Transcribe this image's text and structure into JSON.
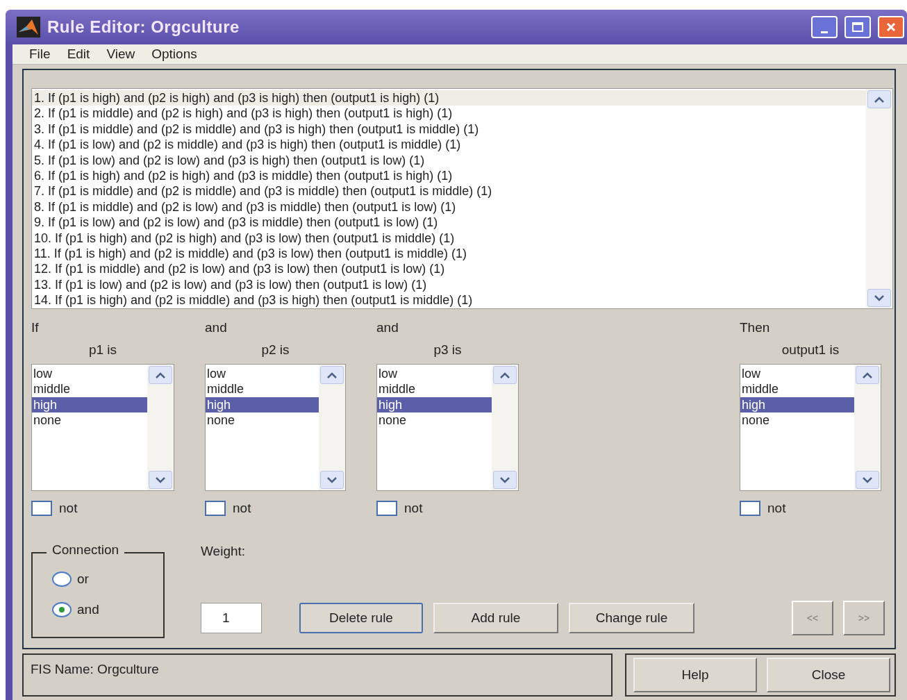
{
  "window": {
    "title": "Rule Editor: Orgculture"
  },
  "menu": [
    "File",
    "Edit",
    "View",
    "Options"
  ],
  "rules": [
    {
      "text": "1. If (p1 is high) and (p2 is high) and (p3 is high) then (output1 is high) (1)",
      "selected": true
    },
    {
      "text": "2. If (p1 is middle) and (p2 is high) and (p3 is high) then (output1 is high) (1)",
      "selected": false
    },
    {
      "text": "3. If (p1 is middle) and (p2 is middle) and (p3 is high) then (output1 is middle) (1)",
      "selected": false
    },
    {
      "text": "4. If (p1 is low) and (p2 is middle) and (p3 is high) then (output1 is middle) (1)",
      "selected": false
    },
    {
      "text": "5. If (p1 is low) and (p2 is low) and (p3 is high) then (output1 is low) (1)",
      "selected": false
    },
    {
      "text": "6. If (p1 is high) and (p2 is high) and (p3 is middle) then (output1 is high) (1)",
      "selected": false
    },
    {
      "text": "7. If (p1 is middle) and (p2 is middle) and (p3 is middle) then (output1 is middle) (1)",
      "selected": false
    },
    {
      "text": "8. If (p1 is middle) and (p2 is low) and (p3 is middle) then (output1 is low) (1)",
      "selected": false
    },
    {
      "text": "9. If (p1 is low) and (p2 is low) and (p3 is middle) then (output1 is low) (1)",
      "selected": false
    },
    {
      "text": "10. If (p1 is high) and (p2 is high) and (p3 is low) then (output1 is middle) (1)",
      "selected": false
    },
    {
      "text": "11. If (p1 is high) and (p2 is middle) and (p3 is low) then (output1 is middle) (1)",
      "selected": false
    },
    {
      "text": "12. If (p1 is middle) and (p2 is low) and (p3 is low) then (output1 is low) (1)",
      "selected": false
    },
    {
      "text": "13. If (p1 is low) and (p2 is low) and (p3 is low) then (output1 is low) (1)",
      "selected": false
    },
    {
      "text": "14. If (p1 is high) and (p2 is middle) and (p3 is high) then (output1 is middle) (1)",
      "selected": false
    }
  ],
  "columns": [
    {
      "kind": "input",
      "connector": "If",
      "label": "p1 is",
      "options": [
        {
          "label": "low",
          "selected": false
        },
        {
          "label": "middle",
          "selected": false
        },
        {
          "label": "high",
          "selected": true
        },
        {
          "label": "none",
          "selected": false
        }
      ],
      "not_label": "not",
      "not_checked": false
    },
    {
      "kind": "input",
      "connector": "and",
      "label": "p2 is",
      "options": [
        {
          "label": "low",
          "selected": false
        },
        {
          "label": "middle",
          "selected": false
        },
        {
          "label": "high",
          "selected": true
        },
        {
          "label": "none",
          "selected": false
        }
      ],
      "not_label": "not",
      "not_checked": false
    },
    {
      "kind": "input",
      "connector": "and",
      "label": "p3 is",
      "options": [
        {
          "label": "low",
          "selected": false
        },
        {
          "label": "middle",
          "selected": false
        },
        {
          "label": "high",
          "selected": true
        },
        {
          "label": "none",
          "selected": false
        }
      ],
      "not_label": "not",
      "not_checked": false
    },
    {
      "kind": "output",
      "connector": "Then",
      "label": "output1 is",
      "options": [
        {
          "label": "low",
          "selected": false
        },
        {
          "label": "middle",
          "selected": false
        },
        {
          "label": "high",
          "selected": true
        },
        {
          "label": "none",
          "selected": false
        }
      ],
      "not_label": "not",
      "not_checked": false
    }
  ],
  "connection": {
    "label": "Connection",
    "options": [
      {
        "label": "or",
        "selected": false
      },
      {
        "label": "and",
        "selected": true
      }
    ]
  },
  "weight": {
    "label": "Weight:",
    "value": "1"
  },
  "buttons": [
    {
      "label": "Delete rule",
      "focused": true
    },
    {
      "label": "Add rule",
      "focused": false
    },
    {
      "label": "Change rule",
      "focused": false
    }
  ],
  "nav": [
    {
      "label": "<<",
      "disabled": true
    },
    {
      "label": ">>",
      "disabled": true
    }
  ],
  "status": "FIS Name: Orgculture",
  "footer_buttons": [
    "Help",
    "Close"
  ]
}
